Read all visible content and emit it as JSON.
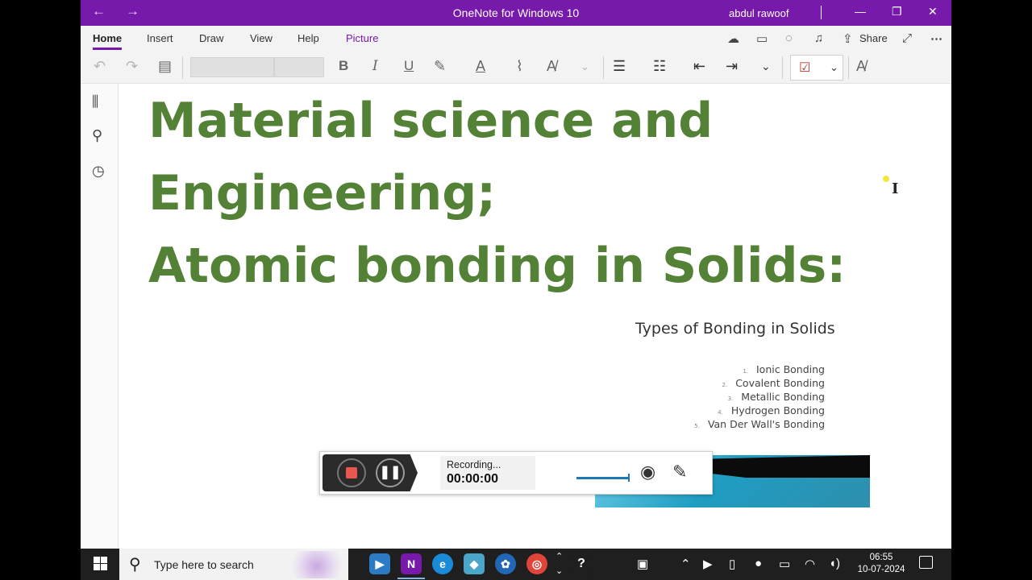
{
  "titlebar": {
    "title": "OneNote for Windows 10",
    "user": "abdul rawoof",
    "back": "←",
    "forward": "→",
    "minimize": "—",
    "restore": "❐",
    "close": "✕",
    "background": "#7719aa"
  },
  "ribbon": {
    "tabs": [
      "Home",
      "Insert",
      "Draw",
      "View",
      "Help",
      "Picture"
    ],
    "active_tab": "Home",
    "share_label": "Share"
  },
  "page": {
    "heading_lines": [
      "Material science and",
      "Engineering;",
      "Atomic bonding in Solids:"
    ],
    "heading_color": "#538135"
  },
  "slide": {
    "title": "Types of Bonding in Solids",
    "items": [
      {
        "num": "1.",
        "label": "Ionic Bonding"
      },
      {
        "num": "2.",
        "label": "Covalent Bonding"
      },
      {
        "num": "3.",
        "label": "Metallic Bonding"
      },
      {
        "num": "4.",
        "label": "Hydrogen Bonding"
      },
      {
        "num": "5.",
        "label": "Van Der Wall's Bonding"
      }
    ]
  },
  "recorder": {
    "status": "Recording...",
    "time": "00:00:00"
  },
  "taskbar": {
    "search_placeholder": "Type here to search",
    "time": "06:55",
    "date": "10-07-2024"
  }
}
